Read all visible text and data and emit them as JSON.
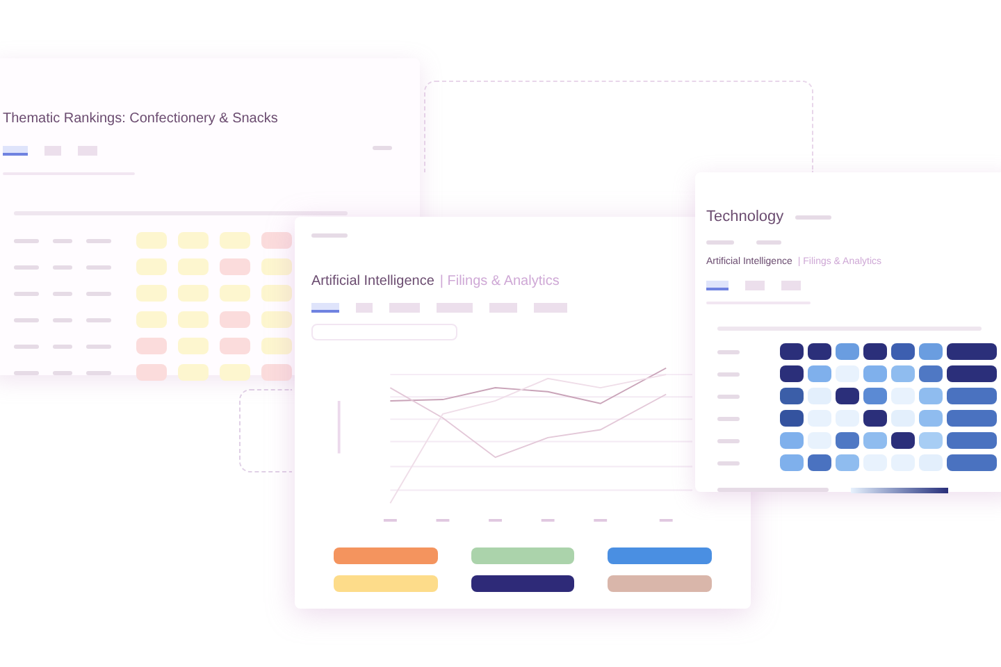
{
  "rankings_window": {
    "title": "Thematic Rankings: Confectionery & Snacks",
    "tabs": [
      {
        "selected": true
      },
      {
        "selected": false
      },
      {
        "selected": false
      }
    ],
    "rows": [
      {
        "cells": [
          {
            "color": "#fdf6cf"
          },
          {
            "color": "#fdf6cf"
          },
          {
            "color": "#fdf6cf"
          },
          {
            "color": "#fbdcdc"
          }
        ]
      },
      {
        "cells": [
          {
            "color": "#fdf6cf"
          },
          {
            "color": "#fdf6cf"
          },
          {
            "color": "#fbdcdc"
          },
          {
            "color": "#fdf6cf"
          }
        ]
      },
      {
        "cells": [
          {
            "color": "#fdf6cf"
          },
          {
            "color": "#fdf6cf"
          },
          {
            "color": "#fdf6cf"
          },
          {
            "color": "#fdf6cf"
          }
        ]
      },
      {
        "cells": [
          {
            "color": "#fdf6cf"
          },
          {
            "color": "#fdf6cf"
          },
          {
            "color": "#fbdcdc"
          },
          {
            "color": "#fdf6cf"
          }
        ]
      },
      {
        "cells": [
          {
            "color": "#fbdcdc"
          },
          {
            "color": "#fdf6cf"
          },
          {
            "color": "#fbdcdc"
          },
          {
            "color": "#fdf6cf"
          }
        ]
      },
      {
        "cells": [
          {
            "color": "#fbdcdc"
          },
          {
            "color": "#fdf6cf"
          },
          {
            "color": "#fdf6cf"
          },
          {
            "color": "#fbdcdc"
          }
        ]
      }
    ]
  },
  "filings_window": {
    "title": "Artificial Intelligence",
    "subtitle": "| Filings & Analytics",
    "tabs": [
      {
        "selected": true
      },
      {
        "selected": false
      },
      {
        "selected": false
      },
      {
        "selected": false
      },
      {
        "selected": false
      },
      {
        "selected": false
      }
    ],
    "legend": [
      {
        "color": "#f4945e"
      },
      {
        "color": "#abd3ab"
      },
      {
        "color": "#4a8fe2"
      },
      {
        "color": "#fddc8a"
      },
      {
        "color": "#2e2a78"
      },
      {
        "color": "#d9b6aa"
      }
    ]
  },
  "technology_window": {
    "title": "Technology",
    "section_title": "Artificial Intelligence",
    "section_subtitle": "| Filings & Analytics",
    "tabs": [
      {
        "selected": true
      },
      {
        "selected": false
      },
      {
        "selected": false
      }
    ],
    "heatmap": [
      {
        "cells": [
          {
            "color": "#2b2f7a"
          },
          {
            "color": "#2b2f7a"
          },
          {
            "color": "#6a9de0"
          },
          {
            "color": "#2b2f7a"
          },
          {
            "color": "#3d5fb0"
          },
          {
            "color": "#6a9de0"
          },
          {
            "color": "#2b2f7a"
          }
        ]
      },
      {
        "cells": [
          {
            "color": "#2b2f7a"
          },
          {
            "color": "#7fb0ec"
          },
          {
            "color": "#e8f2fd"
          },
          {
            "color": "#7fb0ec"
          },
          {
            "color": "#8fbcef"
          },
          {
            "color": "#4f78c4"
          },
          {
            "color": "#2b2f7a"
          }
        ]
      },
      {
        "cells": [
          {
            "color": "#3b5ea8"
          },
          {
            "color": "#e3effc"
          },
          {
            "color": "#2b2f7a"
          },
          {
            "color": "#5b8ad4"
          },
          {
            "color": "#e8f2fd"
          },
          {
            "color": "#8fbcef"
          },
          {
            "color": "#4a72c0"
          }
        ]
      },
      {
        "cells": [
          {
            "color": "#34539f"
          },
          {
            "color": "#e8f2fd"
          },
          {
            "color": "#e8f2fd"
          },
          {
            "color": "#2b2f7a"
          },
          {
            "color": "#e3effc"
          },
          {
            "color": "#8fbcef"
          },
          {
            "color": "#4a72c0"
          }
        ]
      },
      {
        "cells": [
          {
            "color": "#7fb0ec"
          },
          {
            "color": "#e8f2fd"
          },
          {
            "color": "#4f78c4"
          },
          {
            "color": "#8fbcef"
          },
          {
            "color": "#2b2f7a"
          },
          {
            "color": "#a7cdf4"
          },
          {
            "color": "#4a72c0"
          }
        ]
      },
      {
        "cells": [
          {
            "color": "#7fb0ec"
          },
          {
            "color": "#4a72c0"
          },
          {
            "color": "#8fbcef"
          },
          {
            "color": "#e8f2fd"
          },
          {
            "color": "#e8f2fd"
          },
          {
            "color": "#e3effc"
          },
          {
            "color": "#4a72c0"
          }
        ]
      }
    ]
  }
}
